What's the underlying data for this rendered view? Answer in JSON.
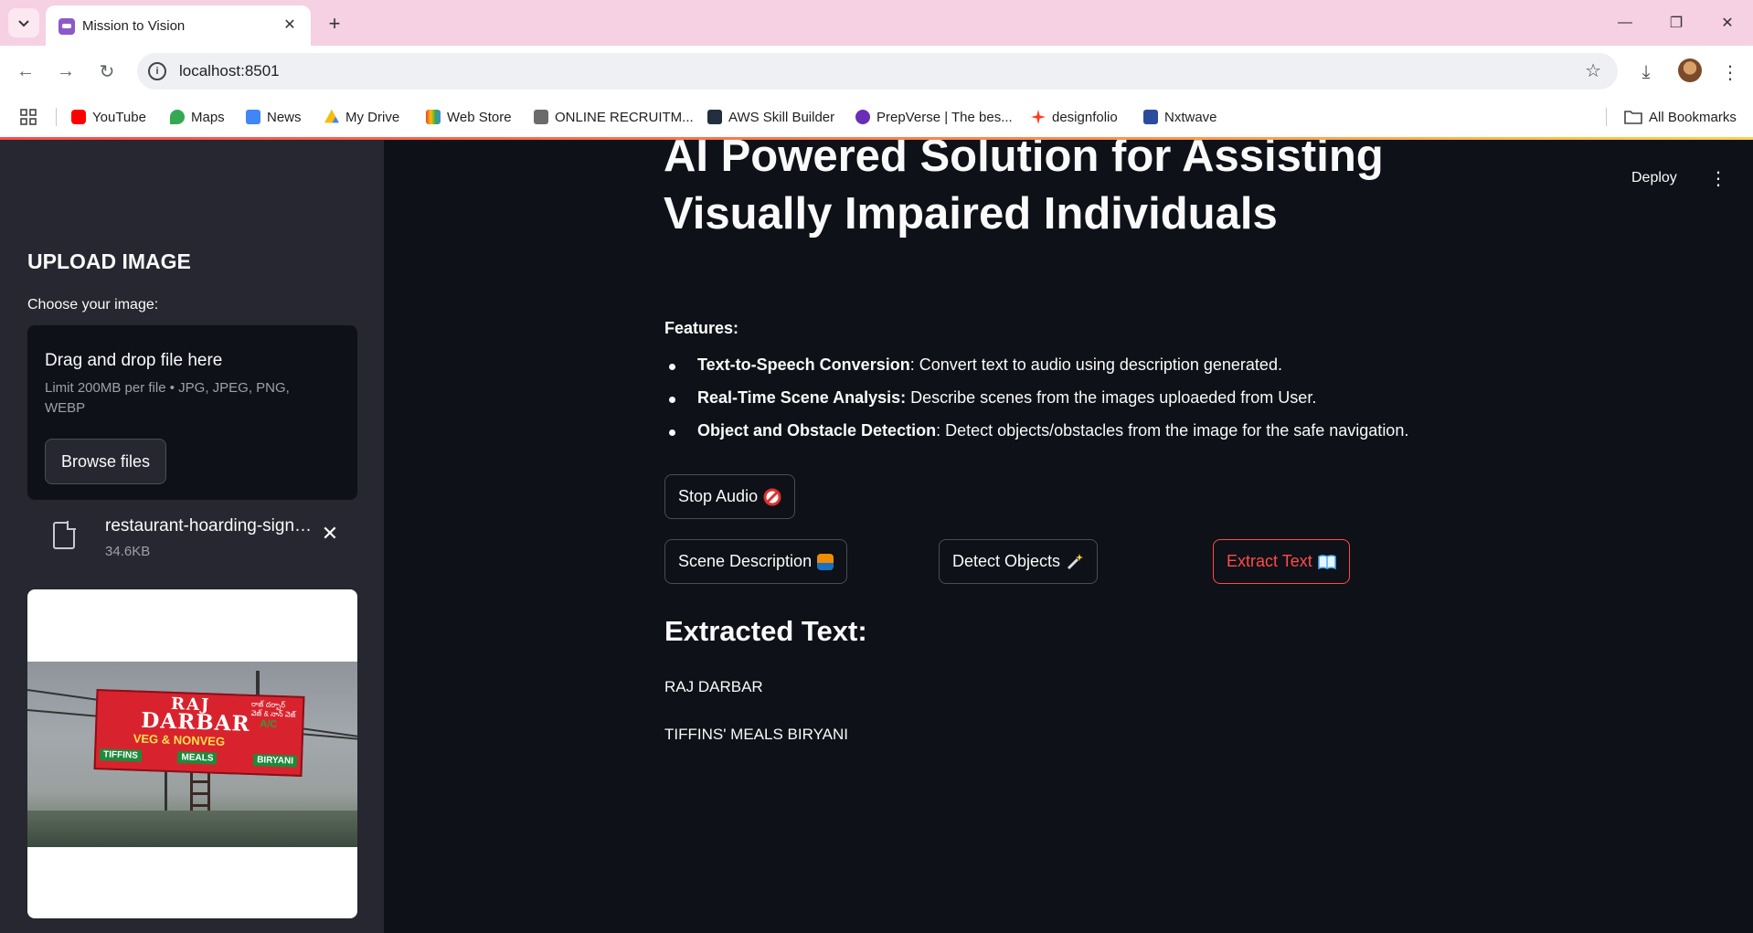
{
  "browser": {
    "tab_title": "Mission to Vision",
    "url": "localhost:8501",
    "bookmarks": [
      {
        "label": "YouTube",
        "color": "#ff0000"
      },
      {
        "label": "Maps",
        "color": "#34a853"
      },
      {
        "label": "News",
        "color": "#4285f4"
      },
      {
        "label": "My Drive",
        "color": "#fbbc04"
      },
      {
        "label": "Web Store",
        "color": "#ea4335"
      },
      {
        "label": "ONLINE RECRUITM...",
        "color": "#6b6b6b"
      },
      {
        "label": "AWS Skill Builder",
        "color": "#232f3e"
      },
      {
        "label": "PrepVerse | The bes...",
        "color": "#6a2db5"
      },
      {
        "label": "designfolio",
        "color": "#ff3b1f"
      },
      {
        "label": "Nxtwave",
        "color": "#2b4c9c"
      }
    ],
    "all_bookmarks_label": "All Bookmarks"
  },
  "sidebar": {
    "title": "UPLOAD IMAGE",
    "uploader_label": "Choose your image:",
    "dropzone_title": "Drag and drop file here",
    "dropzone_limit": "Limit 200MB per file • JPG, JPEG, PNG, WEBP",
    "browse_label": "Browse files",
    "file_name": "restaurant-hoarding-signboard.jpg",
    "file_size": "34.6KB",
    "preview": {
      "sign_line1": "RAJ",
      "sign_line2": "DARBAR",
      "sign_ac": "A/C",
      "sign_line3": "VEG & NONVEG",
      "sign_tiffins": "TIFFINS",
      "sign_meals": "MEALS",
      "sign_biryani": "BIRYANI"
    }
  },
  "main": {
    "deploy_label": "Deploy",
    "title_line1": "AI Powered Solution for Assisting",
    "title_line2": "Visually Impaired Individuals",
    "features_label": "Features:",
    "features": [
      {
        "name": "Text-to-Speech Conversion",
        "desc": ": Convert text to audio using description generated."
      },
      {
        "name": "Real-Time Scene Analysis:",
        "desc": " Describe scenes from the images uploaeded from User."
      },
      {
        "name": "Object and Obstacle Detection",
        "desc": ": Detect objects/obstacles from the image for the safe navigation."
      }
    ],
    "buttons": {
      "stop_audio": "Stop Audio",
      "scene_description": "Scene Description",
      "detect_objects": "Detect Objects",
      "extract_text": "Extract Text"
    },
    "accent_color": "#ff4b4b",
    "extracted_title": "Extracted Text:",
    "extracted_lines": [
      "RAJ DARBAR",
      "TIFFINS' MEALS BIRYANI"
    ]
  }
}
